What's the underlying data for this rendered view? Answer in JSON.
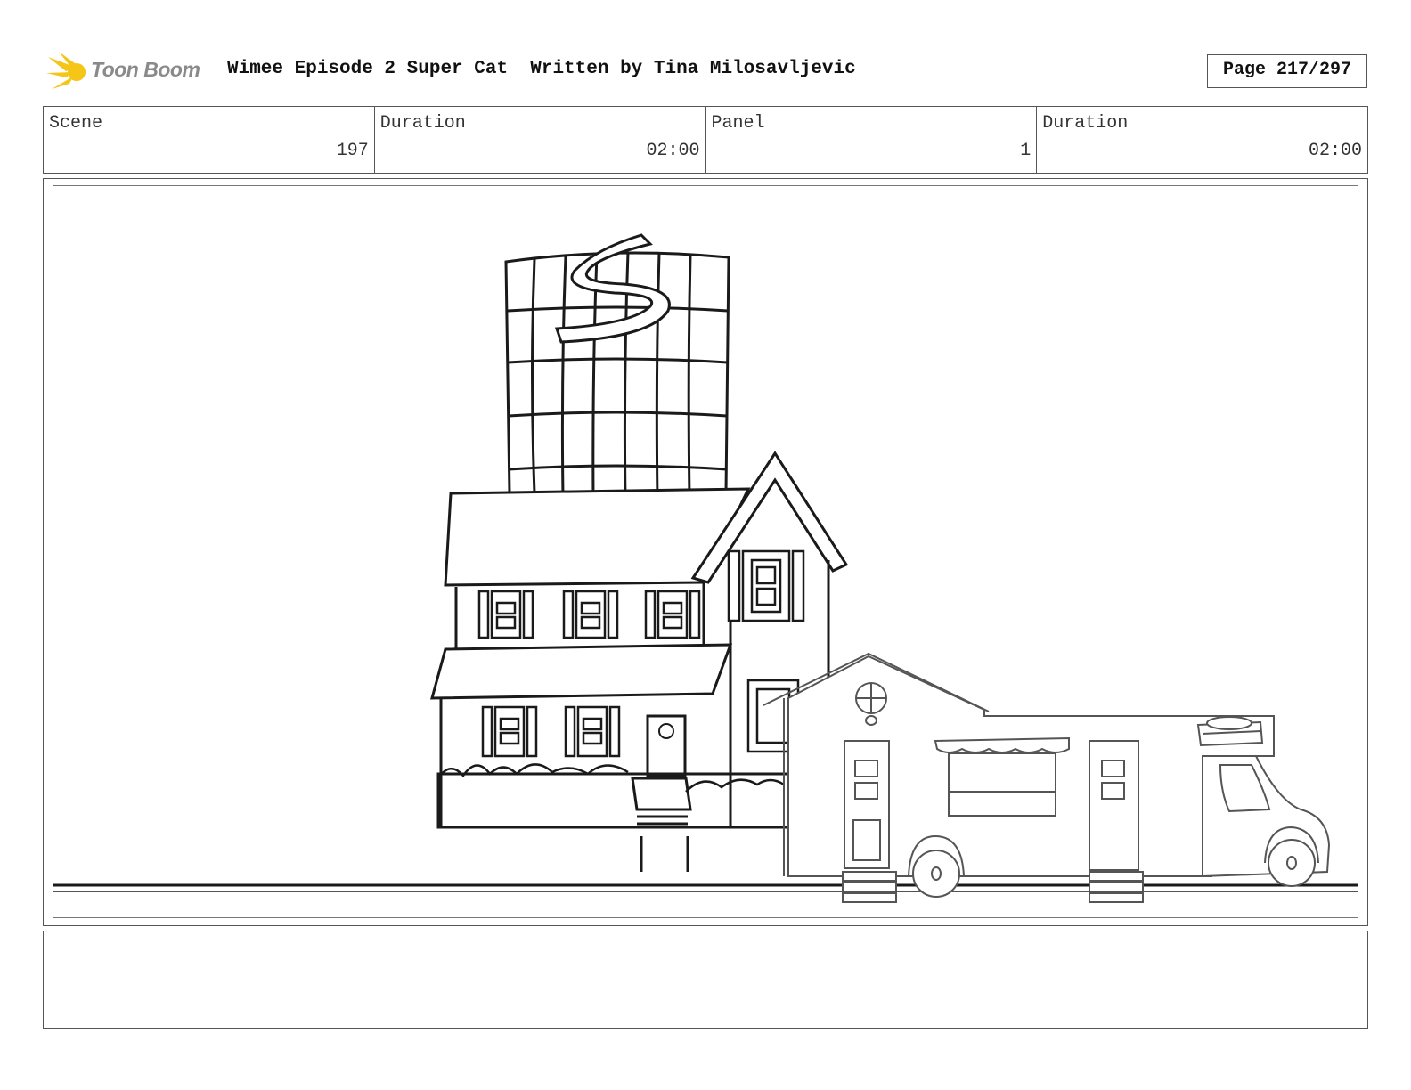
{
  "header": {
    "logo_text": "Toon Boom",
    "title": "Wimee Episode 2 Super Cat  Written by Tina Milosavljevic",
    "page": "Page 217/297"
  },
  "info": {
    "scene_label": "Scene",
    "scene_value": "197",
    "scene_duration_label": "Duration",
    "scene_duration_value": "02:00",
    "panel_label": "Panel",
    "panel_value": "1",
    "panel_duration_label": "Duration",
    "panel_duration_value": "02:00"
  },
  "notes": {
    "text": ""
  },
  "colors": {
    "logo_yellow": "#f5c518",
    "ink": "#1a1a1a",
    "ink_light": "#555555"
  }
}
